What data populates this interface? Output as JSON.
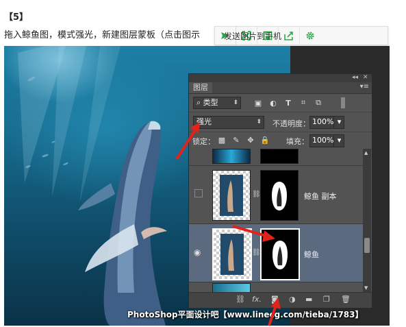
{
  "article": {
    "step": "【5】",
    "instruction": "拖入鲸鱼图，模式强光，新建图层蒙板（点击图示"
  },
  "share_bar": {
    "send_label": "发送图片到手机",
    "icons": [
      "qr-expand-icon",
      "save-icon",
      "share-icon",
      "settings-icon"
    ],
    "accent": "#2ca84a"
  },
  "caption": "PhotoShop平面设计吧【www.linecg.com/tieba/1783】",
  "layers_panel": {
    "panel_ctl_collapse": "◂◂",
    "panel_ctl_close": "✕",
    "tab_label": "图层",
    "filter_label": "类型",
    "blend_mode": "强光",
    "opacity_label": "不透明度：",
    "opacity_value": "100%",
    "lock_label": "锁定：",
    "fill_label": "填充：",
    "fill_value": "100%",
    "layers": [
      {
        "name": "",
        "visible": false,
        "selected": false
      },
      {
        "name": "鲸鱼 副本",
        "visible": false,
        "selected": false
      },
      {
        "name": "鲸鱼",
        "visible": true,
        "selected": true
      }
    ],
    "footer_icons": [
      "link-icon",
      "fx-icon",
      "mask-icon",
      "adjustment-icon",
      "folder-icon",
      "new-layer-icon",
      "trash-icon"
    ],
    "fx_label": "fx."
  },
  "colors": {
    "panel_bg": "#535353",
    "selected_layer": "#5b6a7e",
    "arrow": "#e0231b"
  }
}
